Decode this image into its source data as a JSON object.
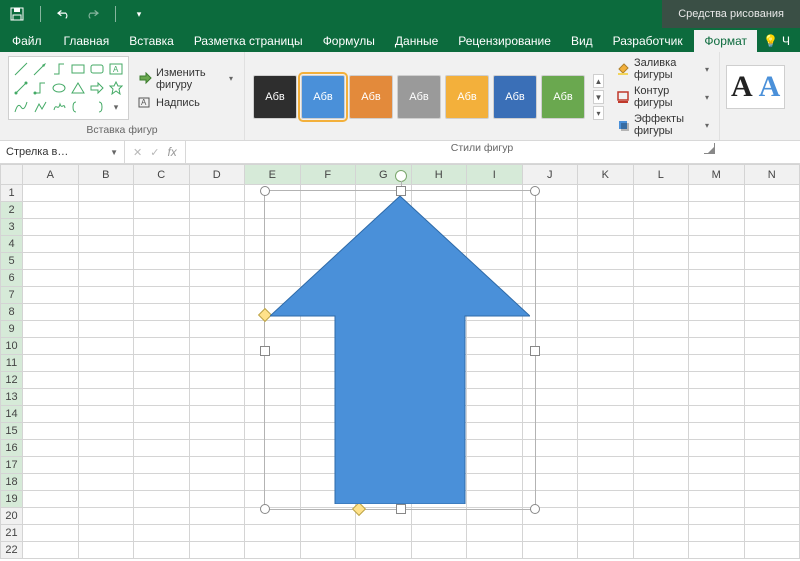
{
  "titlebar": {
    "drawtools_label": "Средства рисования"
  },
  "tabs": {
    "file": "Файл",
    "home": "Главная",
    "insert": "Вставка",
    "pagelayout": "Разметка страницы",
    "formulas": "Формулы",
    "data": "Данные",
    "review": "Рецензирование",
    "view": "Вид",
    "developer": "Разработчик",
    "format": "Формат",
    "tellme": "Ч"
  },
  "ribbon": {
    "insert_shapes": {
      "edit_shape": "Изменить фигуру",
      "text_box": "Надпись",
      "group_label": "Вставка фигур"
    },
    "shape_styles": {
      "swatch_label": "Абв",
      "swatch_colors": [
        "#2e2e2e",
        "#4a90d9",
        "#e38a3b",
        "#9a9a9a",
        "#f3b03b",
        "#3a6fb7",
        "#6aa84f"
      ],
      "selected_index": 1,
      "shape_fill": "Заливка фигуры",
      "shape_outline": "Контур фигуры",
      "shape_effects": "Эффекты фигуры",
      "group_label": "Стили фигур"
    },
    "wordart": {
      "items": [
        "A",
        "A"
      ]
    }
  },
  "namebox": {
    "value": "Стрелка в…"
  },
  "formula_bar": {
    "fx": "fx",
    "value": ""
  },
  "grid": {
    "columns": [
      "A",
      "B",
      "C",
      "D",
      "E",
      "F",
      "G",
      "H",
      "I",
      "J",
      "K",
      "L",
      "M",
      "N"
    ],
    "rows": [
      "1",
      "2",
      "3",
      "4",
      "5",
      "6",
      "7",
      "8",
      "9",
      "10",
      "11",
      "12",
      "13",
      "14",
      "15",
      "16",
      "17",
      "18",
      "19",
      "20",
      "21",
      "22"
    ],
    "sel_cols": [
      "E",
      "F",
      "G",
      "H",
      "I"
    ],
    "sel_rows": [
      "2",
      "3",
      "4",
      "5",
      "6",
      "7",
      "8",
      "9",
      "10",
      "11",
      "12",
      "13",
      "14",
      "15",
      "16",
      "17",
      "18",
      "19"
    ]
  },
  "shape": {
    "fill": "#4a90d9",
    "stroke": "#2e6aa8"
  }
}
